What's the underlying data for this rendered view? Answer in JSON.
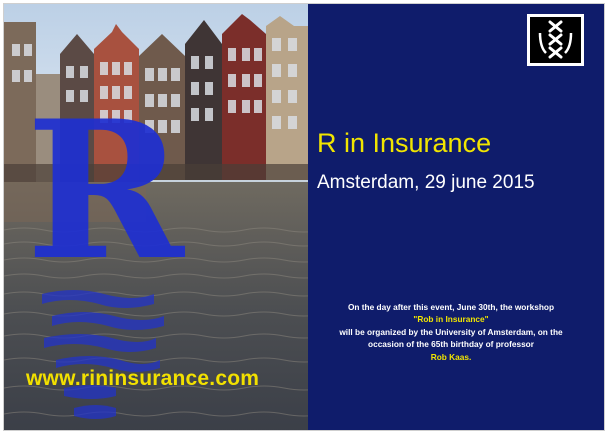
{
  "poster": {
    "letter": "R",
    "url": "www.rininsurance.com",
    "title": "R in Insurance",
    "subtitle": "Amsterdam, 29 june 2015",
    "note": {
      "line1": "On the day after this event, June 30th, the workshop",
      "quoted_title": "\"Rob in Insurance\"",
      "line3": "will be organized by the University of Amsterdam, on the",
      "line4": "occasion of the 65th birthday of professor",
      "professor": "Rob Kaas."
    }
  },
  "logo": {
    "icon": "university-of-amsterdam-crosses-logo"
  },
  "colors": {
    "panel": "#0f1c6b",
    "title_yellow": "#f1e500",
    "letter_blue": "#1e2fd2",
    "text_white": "#ffffff"
  }
}
